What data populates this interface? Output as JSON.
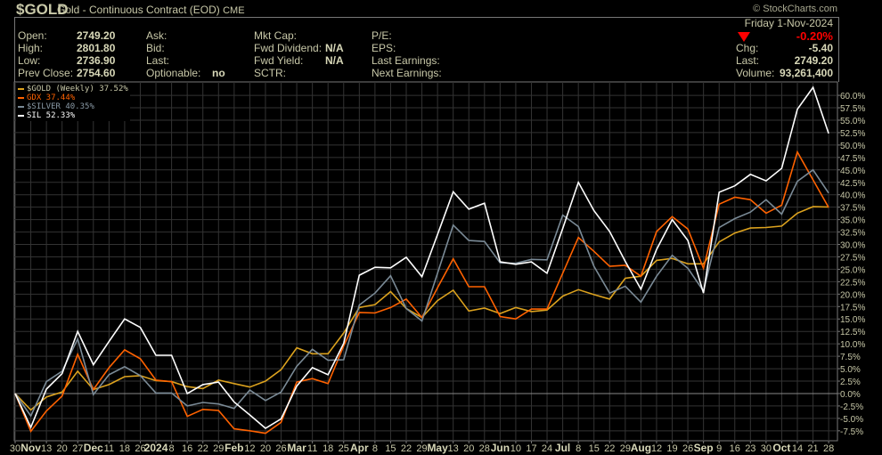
{
  "header": {
    "symbol": "$GOLD",
    "description": "Gold - Continuous Contract (EOD)",
    "exchange": "CME",
    "brand": "© StockCharts.com",
    "date": "Friday  1-Nov-2024",
    "change_pct": "-0.20%",
    "change_direction_icon": "triangle-down-icon",
    "down_color": "#ff0000",
    "fields": {
      "open": {
        "label": "Open:",
        "value": "2749.20"
      },
      "high": {
        "label": "High:",
        "value": "2801.80"
      },
      "low": {
        "label": "Low:",
        "value": "2736.90"
      },
      "prev_close": {
        "label": "Prev Close:",
        "value": "2754.60"
      },
      "ask": {
        "label": "Ask:",
        "value": ""
      },
      "bid": {
        "label": "Bid:",
        "value": ""
      },
      "last_mid": {
        "label": "Last:",
        "value": ""
      },
      "optionable": {
        "label": "Optionable:",
        "value": "no"
      },
      "mkt_cap": {
        "label": "Mkt Cap:",
        "value": ""
      },
      "fwd_dividend": {
        "label": "Fwd Dividend:",
        "value": "N/A"
      },
      "fwd_yield": {
        "label": "Fwd Yield:",
        "value": "N/A"
      },
      "sctr": {
        "label": "SCTR:",
        "value": ""
      },
      "pe": {
        "label": "P/E:",
        "value": ""
      },
      "eps": {
        "label": "EPS:",
        "value": ""
      },
      "last_earnings": {
        "label": "Last Earnings:",
        "value": ""
      },
      "next_earnings": {
        "label": "Next Earnings:",
        "value": ""
      },
      "chg": {
        "label": "Chg:",
        "value": "-5.40"
      },
      "last": {
        "label": "Last:",
        "value": "2749.20"
      },
      "volume": {
        "label": "Volume:",
        "value": "93,261,400"
      }
    }
  },
  "chart_data": {
    "type": "line",
    "title": "",
    "xlabel": "",
    "ylabel": "",
    "ylim": [
      -9.5,
      62.7
    ],
    "grid": true,
    "legend_placement": "top-left",
    "y_ticks": [
      "60.0%",
      "57.5%",
      "55.0%",
      "52.5%",
      "50.0%",
      "47.5%",
      "45.0%",
      "42.5%",
      "40.0%",
      "37.5%",
      "35.0%",
      "32.5%",
      "30.0%",
      "27.5%",
      "25.0%",
      "22.5%",
      "20.0%",
      "17.5%",
      "15.0%",
      "12.5%",
      "10.0%",
      "7.5%",
      "5.0%",
      "2.5%",
      "0.0%",
      "-2.5%",
      "-5.0%",
      "-7.5%"
    ],
    "y_tick_values": [
      60,
      57.5,
      55,
      52.5,
      50,
      47.5,
      45,
      42.5,
      40,
      37.5,
      35,
      32.5,
      30,
      27.5,
      25,
      22.5,
      20,
      17.5,
      15,
      12.5,
      10,
      7.5,
      5,
      2.5,
      0,
      -2.5,
      -5,
      -7.5
    ],
    "x_ticks": [
      {
        "label": "30",
        "bold": false
      },
      {
        "label": "Nov",
        "bold": true
      },
      {
        "label": "13",
        "bold": false
      },
      {
        "label": "20",
        "bold": false
      },
      {
        "label": "27",
        "bold": false
      },
      {
        "label": "Dec",
        "bold": true
      },
      {
        "label": "11",
        "bold": false
      },
      {
        "label": "18",
        "bold": false
      },
      {
        "label": "26",
        "bold": false
      },
      {
        "label": "2024",
        "bold": true
      },
      {
        "label": "8",
        "bold": false
      },
      {
        "label": "16",
        "bold": false
      },
      {
        "label": "22",
        "bold": false
      },
      {
        "label": "29",
        "bold": false
      },
      {
        "label": "Feb",
        "bold": true
      },
      {
        "label": "12",
        "bold": false
      },
      {
        "label": "20",
        "bold": false
      },
      {
        "label": "26",
        "bold": false
      },
      {
        "label": "Mar",
        "bold": true
      },
      {
        "label": "11",
        "bold": false
      },
      {
        "label": "18",
        "bold": false
      },
      {
        "label": "25",
        "bold": false
      },
      {
        "label": "Apr",
        "bold": true
      },
      {
        "label": "8",
        "bold": false
      },
      {
        "label": "15",
        "bold": false
      },
      {
        "label": "22",
        "bold": false
      },
      {
        "label": "29",
        "bold": false
      },
      {
        "label": "May",
        "bold": true
      },
      {
        "label": "13",
        "bold": false
      },
      {
        "label": "20",
        "bold": false
      },
      {
        "label": "28",
        "bold": false
      },
      {
        "label": "Jun",
        "bold": true
      },
      {
        "label": "10",
        "bold": false
      },
      {
        "label": "17",
        "bold": false
      },
      {
        "label": "24",
        "bold": false
      },
      {
        "label": "Jul",
        "bold": true
      },
      {
        "label": "8",
        "bold": false
      },
      {
        "label": "15",
        "bold": false
      },
      {
        "label": "22",
        "bold": false
      },
      {
        "label": "29",
        "bold": false
      },
      {
        "label": "Aug",
        "bold": true
      },
      {
        "label": "12",
        "bold": false
      },
      {
        "label": "19",
        "bold": false
      },
      {
        "label": "26",
        "bold": false
      },
      {
        "label": "Sep",
        "bold": true
      },
      {
        "label": "9",
        "bold": false
      },
      {
        "label": "16",
        "bold": false
      },
      {
        "label": "23",
        "bold": false
      },
      {
        "label": "30",
        "bold": false
      },
      {
        "label": "Oct",
        "bold": true
      },
      {
        "label": "14",
        "bold": false
      },
      {
        "label": "21",
        "bold": false
      },
      {
        "label": "28",
        "bold": false
      }
    ],
    "series": [
      {
        "name": "$GOLD (Weekly) 37.52%",
        "color": "#dca21e",
        "values": [
          0,
          -3.3,
          -0.7,
          0.3,
          4.5,
          0.8,
          1.8,
          3.4,
          3.6,
          2.6,
          2.4,
          1.4,
          1.0,
          2.7,
          2.0,
          1.3,
          2.5,
          4.8,
          9.2,
          8.0,
          8.0,
          12.2,
          17.3,
          17.9,
          20.5,
          17.1,
          15.3,
          18.7,
          20.8,
          16.6,
          17.2,
          16.1,
          17.3,
          16.5,
          16.8,
          19.6,
          20.9,
          19.9,
          19.0,
          23.2,
          23.6,
          26.8,
          27.2,
          26.1,
          26.1,
          30.5,
          32.3,
          33.3,
          33.4,
          33.7,
          36.3,
          37.6,
          37.52
        ]
      },
      {
        "name": "GDX 37.44%",
        "color": "#ff6200",
        "values": [
          0,
          -7.6,
          -3.5,
          -0.5,
          7.9,
          0.8,
          5.2,
          8.8,
          7.0,
          2.7,
          2.4,
          -4.6,
          -3.2,
          -3.4,
          -7.1,
          -7.5,
          -8.0,
          -5.8,
          2.3,
          3.0,
          2.0,
          9.6,
          16.3,
          16.2,
          17.3,
          19.0,
          15.3,
          21.3,
          27.1,
          21.5,
          21.5,
          15.5,
          15.0,
          17.0,
          17.0,
          24.2,
          31.4,
          28.6,
          25.6,
          25.8,
          23.6,
          32.6,
          35.6,
          33.1,
          25.2,
          38.1,
          39.5,
          39.0,
          36.3,
          37.9,
          48.6,
          43.0,
          37.44
        ]
      },
      {
        "name": "$SILVER 40.35%",
        "color": "#7a8a96",
        "values": [
          0,
          -4.5,
          2.4,
          4.5,
          11.0,
          -0.2,
          3.8,
          5.4,
          3.6,
          0.1,
          0.1,
          -2.5,
          -1.8,
          -2.1,
          -3.0,
          0.7,
          -1.4,
          0.3,
          5.5,
          8.9,
          6.7,
          6.8,
          17.8,
          20.2,
          23.7,
          17.1,
          14.6,
          24.2,
          33.9,
          30.8,
          30.6,
          26.3,
          26.2,
          27.0,
          26.9,
          35.9,
          33.6,
          25.6,
          20.2,
          21.6,
          18.4,
          23.6,
          27.8,
          25.2,
          20.6,
          33.4,
          35.2,
          36.5,
          39.0,
          36.1,
          42.7,
          45.0,
          40.35
        ]
      },
      {
        "name": "SIL 52.33%",
        "color": "#ffffff",
        "values": [
          0,
          -6.8,
          0.9,
          4.0,
          12.5,
          5.8,
          10.5,
          15.0,
          13.3,
          7.7,
          7.7,
          0,
          1.8,
          2.3,
          -1.7,
          -4.3,
          -7.0,
          -5.1,
          1.5,
          5.2,
          3.8,
          10.1,
          23.8,
          25.4,
          25.3,
          27.4,
          23.5,
          32.0,
          40.6,
          37.1,
          38.3,
          26.5,
          26.0,
          26.5,
          24.2,
          33.2,
          42.5,
          36.8,
          32.6,
          26.6,
          21.0,
          29.0,
          35.0,
          30.8,
          20.2,
          40.5,
          41.8,
          44.1,
          42.8,
          45.3,
          57.2,
          61.6,
          52.33
        ]
      }
    ]
  }
}
